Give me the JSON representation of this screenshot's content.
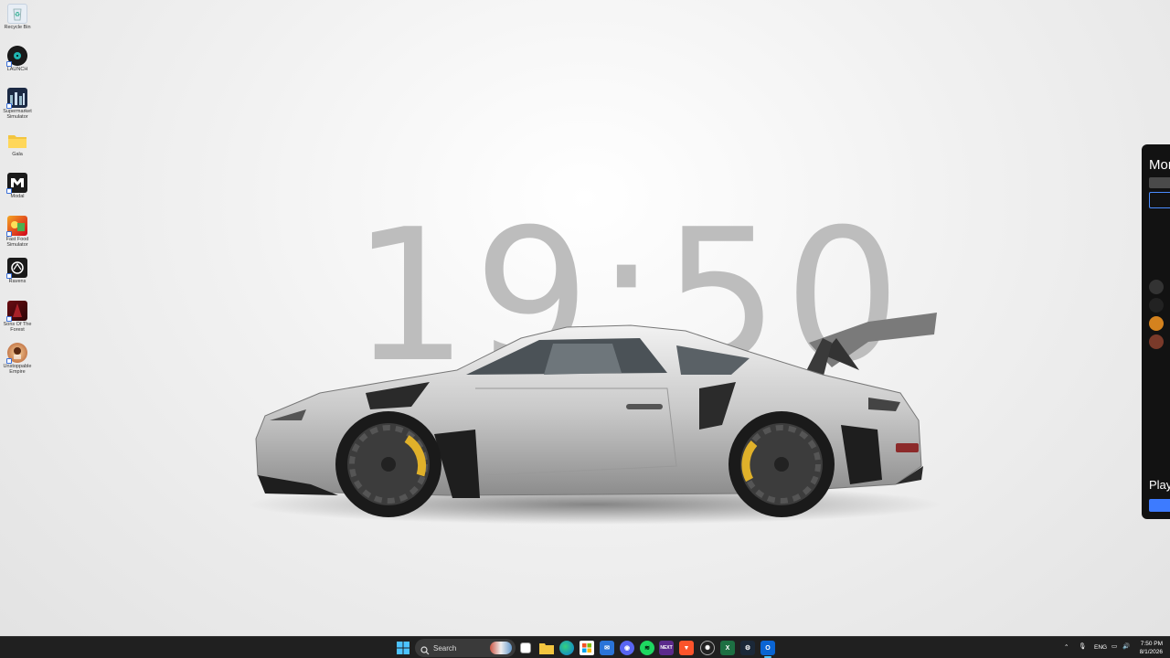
{
  "desktop": {
    "icons": [
      {
        "label": "Recycle Bin",
        "icon": "recycle-bin-icon"
      },
      {
        "label": "LAUNCH",
        "icon": "vinyl-disc-icon"
      },
      {
        "label": "Supermarket Simulator",
        "icon": "supermarket-icon"
      },
      {
        "label": "Gala",
        "icon": "folder-icon"
      },
      {
        "label": "Modal",
        "icon": "modal-logo-icon"
      },
      {
        "label": "Fast Food Simulator",
        "icon": "fast-food-icon"
      },
      {
        "label": "Ravens",
        "icon": "ravens-icon"
      },
      {
        "label": "Sons Of The Forest",
        "icon": "sons-of-the-forest-icon"
      },
      {
        "label": "Unstoppable Empire",
        "icon": "game-icon"
      }
    ],
    "clock_overlay": "19:50"
  },
  "side_panel": {
    "title": "Mor",
    "play_label": "Play",
    "accent": "#3d7bff"
  },
  "taskbar": {
    "search_label": "Search",
    "apps": [
      "windows-start-icon",
      "task-view-icon",
      "file-explorer-icon",
      "edge-icon",
      "store-icon",
      "mail-icon",
      "discord-icon",
      "spotify-icon",
      "nextjs-icon",
      "brave-icon",
      "chatgpt-icon",
      "excel-icon",
      "steam-icon",
      "outlook-icon"
    ],
    "next_label": "NEXT",
    "tray": {
      "language": "ENG",
      "time": "7:50 PM",
      "date": "8/1/2026"
    }
  }
}
